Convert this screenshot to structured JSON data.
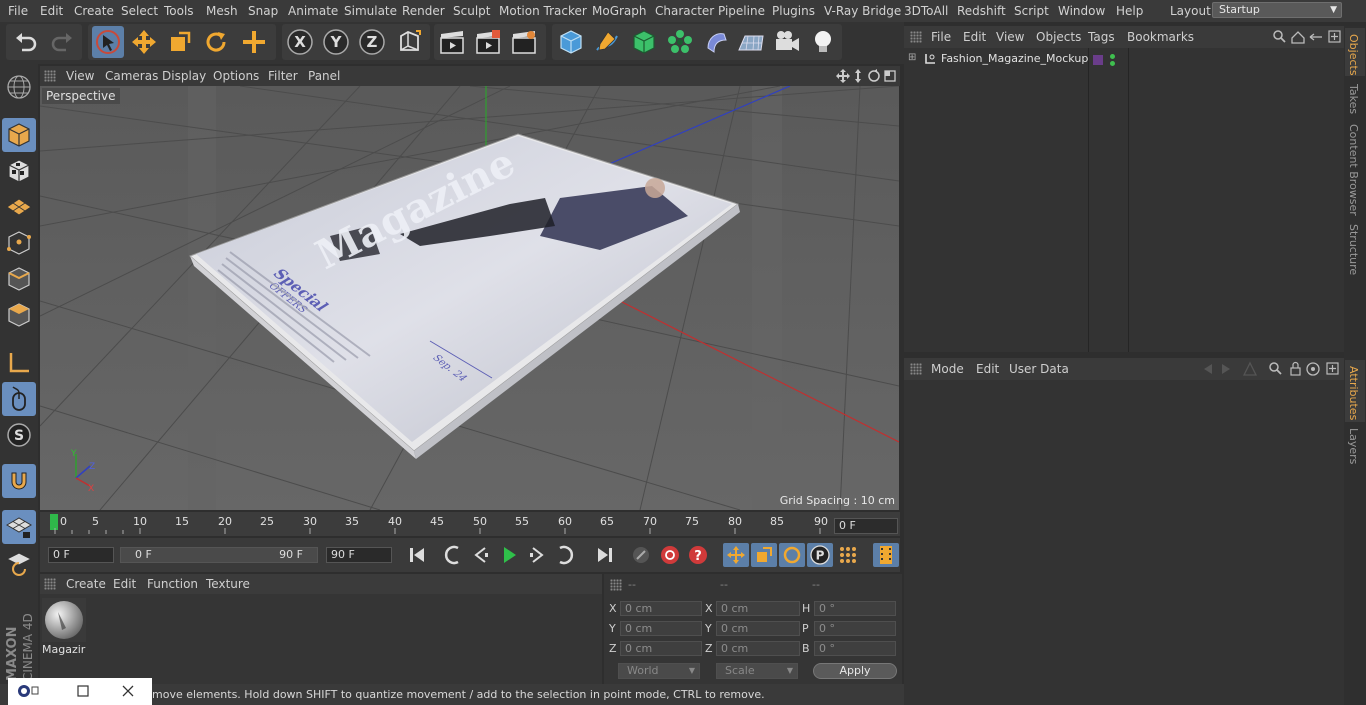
{
  "menubar": {
    "items": [
      "File",
      "Edit",
      "Create",
      "Select",
      "Tools",
      "Mesh",
      "Snap",
      "Animate",
      "Simulate",
      "Render",
      "Sculpt",
      "Motion Tracker",
      "MoGraph",
      "Character",
      "Pipeline",
      "Plugins",
      "V-Ray Bridge",
      "3DToAll",
      "Redshift",
      "Script",
      "Window",
      "Help"
    ],
    "layout_label": "Layout:",
    "layout_value": "Startup"
  },
  "viewport": {
    "menu": [
      "View",
      "Cameras",
      "Display",
      "Options",
      "Filter",
      "Panel"
    ],
    "camera_label": "Perspective",
    "grid_spacing": "Grid Spacing : 10 cm",
    "cover": {
      "title": "Magazine",
      "special": "Special",
      "offers": "OFFERS",
      "date": "Sep. 24"
    },
    "axis_labels": {
      "x": "X",
      "y": "Y",
      "z": "Z"
    }
  },
  "timeline": {
    "ticks": [
      "0",
      "5",
      "10",
      "15",
      "20",
      "25",
      "30",
      "35",
      "40",
      "45",
      "50",
      "55",
      "60",
      "65",
      "70",
      "75",
      "80",
      "85",
      "90"
    ],
    "current_frame": "0 F"
  },
  "transport": {
    "start_frame": "0 F",
    "range_start": "0 F",
    "range_end": "90 F",
    "end_frame": "90 F"
  },
  "material_panel": {
    "menu": [
      "Create",
      "Edit",
      "Function",
      "Texture"
    ],
    "material_name": "Magazir"
  },
  "coordinates": {
    "headers": [
      "--",
      "--",
      "--"
    ],
    "rows": [
      {
        "l1": "X",
        "v1": "0 cm",
        "l2": "X",
        "v2": "0 cm",
        "l3": "H",
        "v3": "0 °"
      },
      {
        "l1": "Y",
        "v1": "0 cm",
        "l2": "Y",
        "v2": "0 cm",
        "l3": "P",
        "v3": "0 °"
      },
      {
        "l1": "Z",
        "v1": "0 cm",
        "l2": "Z",
        "v2": "0 cm",
        "l3": "B",
        "v3": "0 °"
      }
    ],
    "space": "World",
    "mode": "Scale",
    "apply": "Apply"
  },
  "object_manager": {
    "menu": [
      "File",
      "Edit",
      "View",
      "Objects",
      "Tags",
      "Bookmarks"
    ],
    "objects": [
      {
        "name": "Fashion_Magazine_Mockup",
        "layer_color": "#6a3d8a",
        "status_color": "#3fbf4f"
      }
    ]
  },
  "attribute_manager": {
    "menu": [
      "Mode",
      "Edit",
      "User Data"
    ]
  },
  "side_tabs": {
    "top": [
      "Objects",
      "Takes",
      "Content Browser",
      "Structure"
    ],
    "bottom": [
      "Attributes",
      "Layers"
    ]
  },
  "status_bar": {
    "text": "move elements. Hold down SHIFT to quantize movement / add to the selection in point mode, CTRL to remove."
  },
  "branding": {
    "vertical_logo": "MAXON CINEMA 4D"
  },
  "colors": {
    "accent_selected": "#5c7fa8",
    "axis_x": "#c03030",
    "axis_y": "#30a030",
    "axis_z": "#3040c0",
    "active_tab": "#e8a84c"
  }
}
